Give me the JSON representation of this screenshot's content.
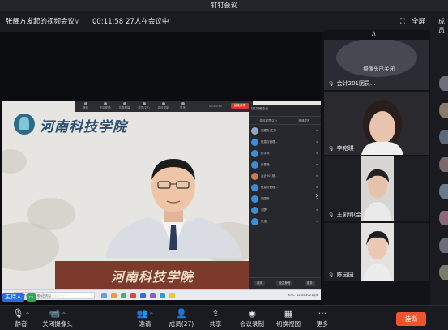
{
  "window": {
    "title": "钉钉会议"
  },
  "info": {
    "meeting_title": "张耀方发起的视频会议",
    "duration": "00:11:58",
    "attendance": "27人在会议中",
    "fullscreen_label": "全屏",
    "right_rail_label": "成员"
  },
  "share": {
    "logo_text": "河南科技学院",
    "desk_text": "河南科技学院",
    "toolbar_items": [
      "静音",
      "开启视频",
      "共享屏幕",
      "成员(27)",
      "会议录制",
      "更多"
    ],
    "toolbar_time": "00:11:53",
    "toolbar_end": "结束共享",
    "member_panel": {
      "header": "钉钉视频会议",
      "tabs": [
        "会议成员(27)",
        "申请发言"
      ],
      "rows": [
        "张耀方(主持...",
        "信息与管理...",
        "彭宇亮",
        "彭春艳",
        "会计201班...",
        "信息与管理...",
        "张国栋",
        "刘梦",
        "张浩"
      ],
      "buttons": [
        "邀请",
        "全员静音",
        "更多"
      ]
    },
    "taskbar": {
      "search_placeholder": "在这里输入你要搜索的内容",
      "temperature": "30°C",
      "time": "12:01",
      "date": "2021/5/6"
    }
  },
  "host": {
    "badge": "主持人",
    "name": "张耀方"
  },
  "tiles": [
    {
      "label": "会计201团员...",
      "status": "摄像头已关闭"
    },
    {
      "label": "李宛琪"
    },
    {
      "label": "王凯璐(会..."
    },
    {
      "label": "陈园园"
    }
  ],
  "toolbar": {
    "mute": "静音",
    "camera_off": "关闭摄像头",
    "invite": "邀请",
    "members": "成员(27)",
    "share": "共享",
    "record": "会议录制",
    "layout": "切换视图",
    "more": "更多",
    "hangup": "挂断"
  }
}
